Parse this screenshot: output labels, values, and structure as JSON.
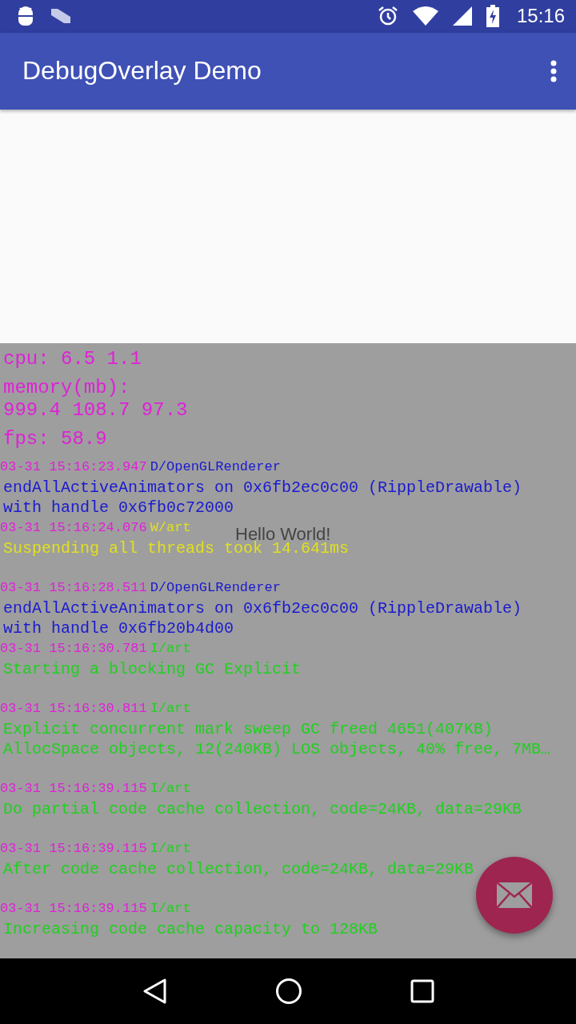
{
  "status_bar": {
    "time": "15:16"
  },
  "app_bar": {
    "title": "DebugOverlay Demo"
  },
  "content": {
    "text": "Hello World!"
  },
  "overlay": {
    "stats": [
      {
        "lines": [
          "cpu: 6.5 1.1"
        ]
      },
      {
        "lines": [
          "memory(mb):",
          "999.4 108.7 97.3"
        ]
      },
      {
        "lines": [
          "fps: 58.9"
        ]
      }
    ],
    "log": [
      {
        "time": "03-31 15:16:23.947",
        "tag": "D/OpenGLRenderer",
        "kind": "debug",
        "message": "endAllActiveAnimators on 0x6fb2ec0c00 (RippleDrawable) with handle 0x6fb0c72000"
      },
      {
        "time": "03-31 15:16:24.076",
        "tag": "W/art",
        "kind": "warn",
        "message": "Suspending all threads took 14.641ms"
      },
      {
        "time": "03-31 15:16:28.511",
        "tag": "D/OpenGLRenderer",
        "kind": "debug",
        "message": "endAllActiveAnimators on 0x6fb2ec0c00 (RippleDrawable) with handle 0x6fb20b4d00"
      },
      {
        "time": "03-31 15:16:30.781",
        "tag": "I/art",
        "kind": "info",
        "message": "Starting a blocking GC Explicit"
      },
      {
        "time": "03-31 15:16:30.811",
        "tag": "I/art",
        "kind": "info",
        "message": "Explicit concurrent mark sweep GC freed 4651(407KB) AllocSpace objects, 12(240KB) LOS objects, 40% free, 7MB…"
      },
      {
        "time": "03-31 15:16:39.115",
        "tag": "I/art",
        "kind": "info",
        "message": "Do partial code cache collection, code=24KB, data=29KB"
      },
      {
        "time": "03-31 15:16:39.115",
        "tag": "I/art",
        "kind": "info",
        "message": "After code cache collection, code=24KB, data=29KB"
      },
      {
        "time": "03-31 15:16:39.115",
        "tag": "I/art",
        "kind": "info",
        "message": "Increasing code cache capacity to 128KB"
      }
    ]
  }
}
